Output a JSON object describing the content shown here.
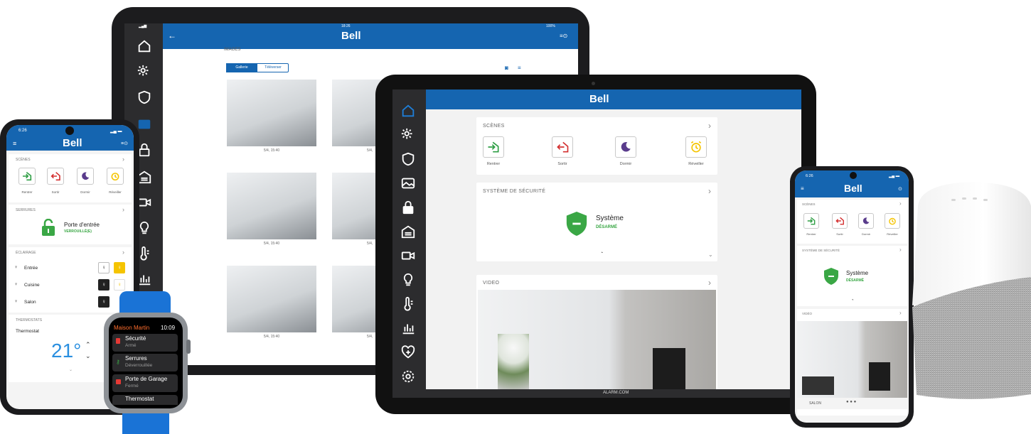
{
  "brand": "Bell",
  "colors": {
    "brand_blue": "#1565b0",
    "enter_green": "#2e9e44",
    "exit_red": "#d32f2f",
    "sleep_purple": "#5a3c8c",
    "wake_yellow": "#f5c400",
    "security_green": "#3aa745"
  },
  "back_tablet": {
    "time": "18:26",
    "battery": "100%",
    "section_title": "IMAGES",
    "tabs": [
      "Gallerie",
      "Téléverser"
    ],
    "captions": [
      "5/4, 15:40",
      "5/4,",
      "5/4, 15:40",
      "5/4,",
      "5/4, 15:40",
      "5/4,"
    ]
  },
  "center_tablet": {
    "scenes_title": "SCÈNES",
    "scenes": [
      "Rentrer",
      "Sortir",
      "Dormir",
      "Réveiller"
    ],
    "security_title": "SYSTÈME DE SÉCURITÉ",
    "security_name": "Système",
    "security_state": "DÉSARMÉ",
    "video_title": "VIDEO",
    "footer": "ALARM.COM"
  },
  "left_phone": {
    "time": "6:26",
    "scenes_title": "SCÈNES",
    "scenes": [
      "Rentrer",
      "Sortir",
      "Dormir",
      "Réveiller"
    ],
    "locks_title": "SERRURES",
    "lock_name": "Porte d'entrée",
    "lock_state": "VERROUILLÉ(E)",
    "lighting_title": "ÉCLAIRAGE",
    "lights": [
      "Entrée",
      "Cuisine",
      "Salon"
    ],
    "thermostats_title": "THERMOSTATS",
    "thermostat_name": "Thermostat",
    "temperature": "21°"
  },
  "watch": {
    "home_name": "Maison Martin",
    "time": "10:09",
    "items": [
      {
        "title": "Sécurité",
        "state": "Armé"
      },
      {
        "title": "Serrures",
        "state": "Déverrouillée"
      },
      {
        "title": "Porte de Garage",
        "state": "Fermé"
      },
      {
        "title": "Thermostat",
        "state": ""
      }
    ]
  },
  "right_phone": {
    "time": "6:26",
    "scenes_title": "SCÈNES",
    "scenes": [
      "Rentrer",
      "Sortir",
      "Dormir",
      "Réveiller"
    ],
    "security_title": "SYSTÈME DE SÉCURITÉ",
    "security_name": "Système",
    "security_state": "DÉSARMÉ",
    "video_title": "VIDÉO",
    "camera_label": "SALON"
  }
}
